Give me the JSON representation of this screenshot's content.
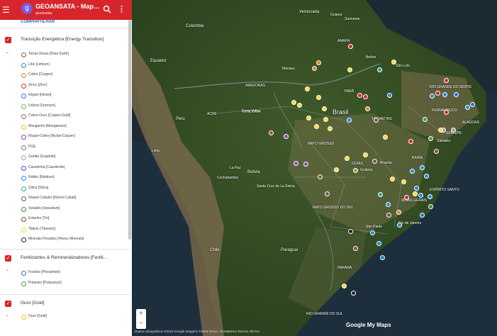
{
  "app": {
    "title": "GEOANSATA - Mapa d...",
    "subtitle": "geoansata",
    "logo_letter": "g",
    "share_label": "COMPARTILHAR"
  },
  "colors": {
    "header": "#d6262b",
    "accent": "#7b5ae0"
  },
  "layers": [
    {
      "title": "Transição Energética [Energy Transition]",
      "items": [
        {
          "label": "Terras Raras [Rare Earth]",
          "color": "#a0522d"
        },
        {
          "label": "Lítio [Lithium]",
          "color": "#2e86de"
        },
        {
          "label": "Cobre [Copper]",
          "color": "#e67e22"
        },
        {
          "label": "Zinco [Zinc]",
          "color": "#c0392b"
        },
        {
          "label": "Níquel [Nickel]",
          "color": "#3c6fd4"
        },
        {
          "label": "Urânio [Uranium]",
          "color": "#7cb342"
        },
        {
          "label": "Cobre-Ouro [Copper-Gold]",
          "color": "#8d6e63"
        },
        {
          "label": "Manganês [Manganese]",
          "color": "#f1c40f"
        },
        {
          "label": "Níquel-Cobre [Nickel-Copper]",
          "color": "#8e44ad"
        },
        {
          "label": "PGE",
          "color": "#757575"
        },
        {
          "label": "Grafite [Graphite]",
          "color": "#9e9e9e"
        },
        {
          "label": "Cassiterita [Cassiterite]",
          "color": "#673ab7"
        },
        {
          "label": "Nióbio [Niobium]",
          "color": "#1e88e5"
        },
        {
          "label": "Sílica [Silica]",
          "color": "#26a69a"
        },
        {
          "label": "Níquel-Cobalto [Nickel-Cobalt]",
          "color": "#795548"
        },
        {
          "label": "Vanádio [Vanadium]",
          "color": "#388e3c"
        },
        {
          "label": "Estanho [Tin]",
          "color": "#6d4c41"
        },
        {
          "label": "Titânio [Titanium]",
          "color": "#fdd835"
        },
        {
          "label": "Minerais Pesados [Heavy Minerals]",
          "color": "#212121"
        }
      ]
    },
    {
      "title": "Fertilizantes & Remineralizadores [Fertili...",
      "items": [
        {
          "label": "Fosfato [Phosphate]",
          "color": "#1976d2"
        },
        {
          "label": "Potássio [Potassium]",
          "color": "#43a047"
        }
      ]
    },
    {
      "title": "Ouro [Gold]",
      "items": [
        {
          "label": "Ouro [Gold]",
          "color": "#fbc02d"
        }
      ]
    }
  ],
  "map": {
    "labels": {
      "venezuela": "Venezuela",
      "colombia": "Colombia",
      "equador": "Equador",
      "peru": "Peru",
      "bolivia": "Bolivia",
      "chile": "Chile",
      "paraguai": "Paraguai",
      "brasil": "Brasil",
      "amazonas": "AMAZONAS",
      "mato_grosso": "MATO GROSSO",
      "bahia": "BAHIA",
      "minas": "MINAS GERAIS",
      "sao_paulo": "São Paulo",
      "rio": "Rio de Janeiro",
      "salvador": "Salvador",
      "manaus": "Manaus",
      "belem": "Belém",
      "la_paz": "La Paz",
      "cochabamba": "Cochabamba",
      "santa_cruz": "Santa Cruz de La Sierra",
      "goiania": "Goiânia",
      "brasilia": "Brasília",
      "pernambuco": "PERNAMBUCO",
      "sergipe": "SERGIPE",
      "alagoas": "ALAGOAS",
      "rio_grande_norte": "RIO GRANDE DO NORTE",
      "para": "PARÁ",
      "acre": "ACRE",
      "rondonia": "RONDÔNIA",
      "sao_luis": "São Luís",
      "lima": "Lima",
      "porto_velho": "Porto Velho",
      "goias": "GOIÁS",
      "espirito_santo": "ESPÍRITO SANTO",
      "parana": "PARANÁ",
      "mato_grosso_sul": "MATO GROSSO DO SUL",
      "rs": "RIO GRANDE DO SUL",
      "tocantins": "TOCANTINS",
      "amapa": "AMAPÁ",
      "guiana": "Guiana",
      "suriname": "Suriname"
    },
    "attribution": "Dados cartográficos ©2024 Google Imagens ©2024 NASA, TerraMetrics   Termos   200 km",
    "logo": "Google My Maps"
  }
}
